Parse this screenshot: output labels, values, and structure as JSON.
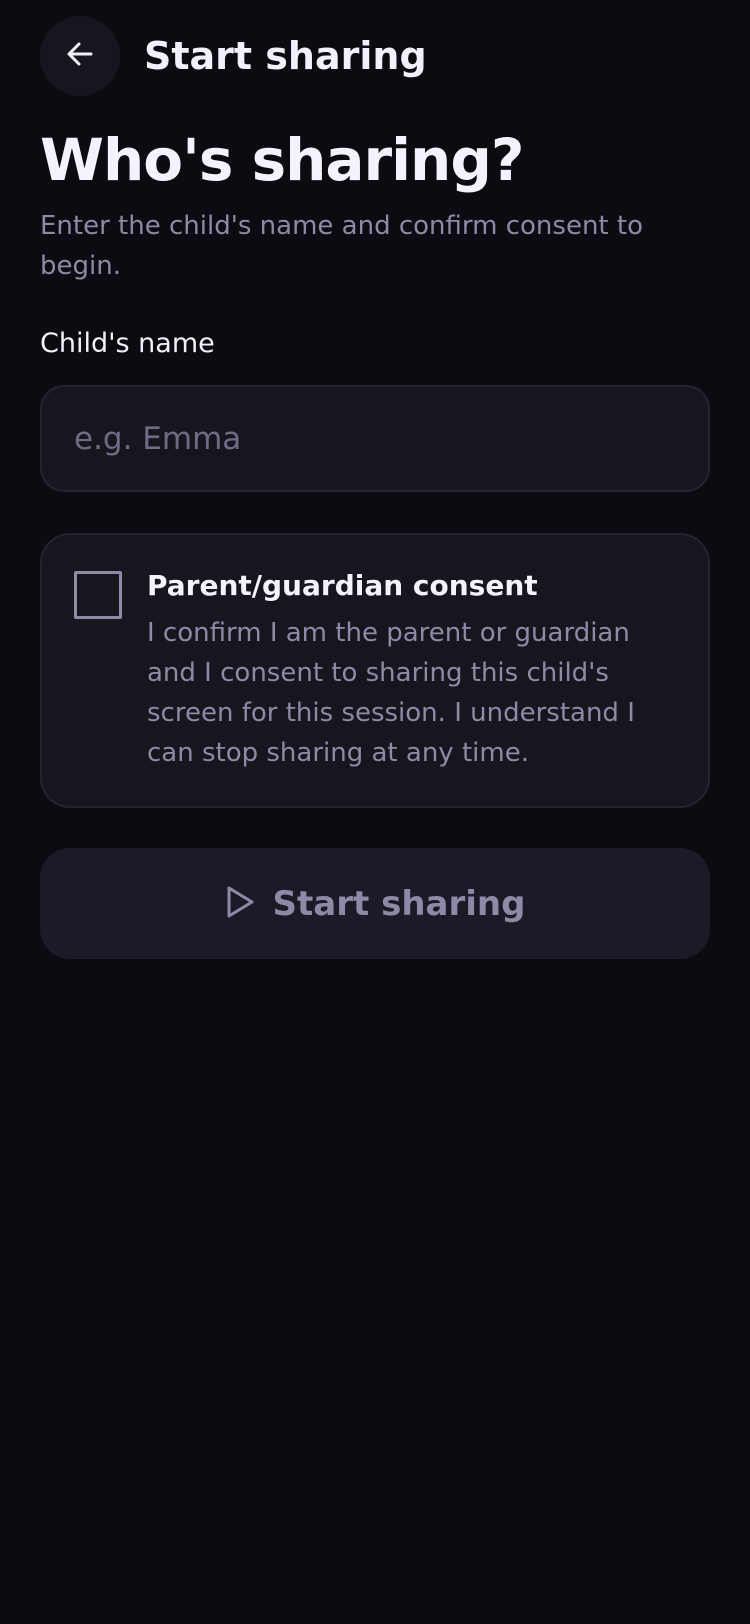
{
  "header": {
    "title": "Start sharing",
    "back_icon": "arrow-left-icon"
  },
  "main": {
    "title": "Who's sharing?",
    "subtitle": "Enter the child's name and confirm consent to begin.",
    "name_field": {
      "label": "Child's name",
      "placeholder": "e.g. Emma",
      "value": ""
    },
    "consent": {
      "checked": false,
      "title": "Parent/guardian consent",
      "text": "I confirm I am the parent or guardian and I consent to sharing this child's screen for this session. I understand I can stop sharing at any time."
    },
    "start_button": {
      "label": "Start sharing",
      "icon": "play-icon",
      "enabled": false
    }
  },
  "colors": {
    "background": "#0c0b11",
    "surface": "#17161f",
    "text_primary": "#f2f0f8",
    "text_muted": "#8d89a6"
  }
}
